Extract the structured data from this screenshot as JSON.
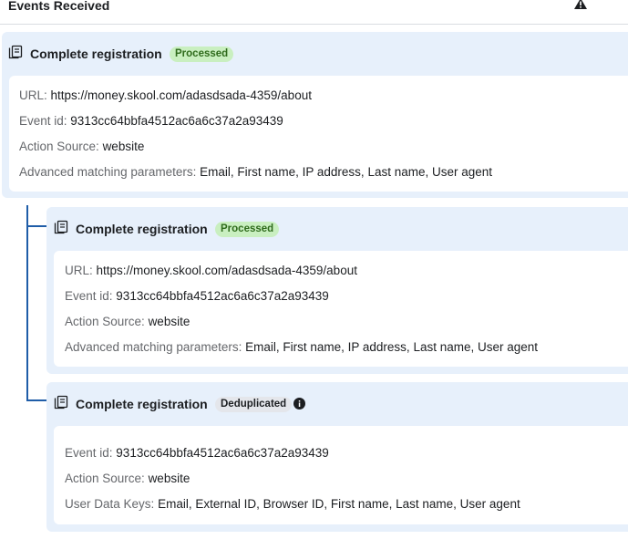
{
  "header": {
    "title": "Events Received",
    "warning_icon": "warning-triangle-icon"
  },
  "events": [
    {
      "title": "Complete registration",
      "status": "Processed",
      "rows": [
        {
          "label": "URL:",
          "value": "https://money.skool.com/adasdsada-4359/about"
        },
        {
          "label": "Event id:",
          "value": "9313cc64bbfa4512ac6a6c37a2a93439"
        },
        {
          "label": "Action Source:",
          "value": "website"
        },
        {
          "label": "Advanced matching parameters:",
          "value": "Email, First name, IP address, Last name, User agent"
        }
      ]
    },
    {
      "title": "Complete registration",
      "status": "Processed",
      "rows": [
        {
          "label": "URL:",
          "value": "https://money.skool.com/adasdsada-4359/about"
        },
        {
          "label": "Event id:",
          "value": "9313cc64bbfa4512ac6a6c37a2a93439"
        },
        {
          "label": "Action Source:",
          "value": "website"
        },
        {
          "label": "Advanced matching parameters:",
          "value": "Email, First name, IP address, Last name, User agent"
        }
      ]
    },
    {
      "title": "Complete registration",
      "status": "Deduplicated",
      "rows": [
        {
          "label": "Event id:",
          "value": "9313cc64bbfa4512ac6a6c37a2a93439"
        },
        {
          "label": "Action Source:",
          "value": "website"
        },
        {
          "label": "User Data Keys:",
          "value": "Email, External ID, Browser ID, First name, Last name, User agent"
        }
      ]
    }
  ],
  "colors": {
    "card_bg": "#e7f0fb",
    "processed_badge_bg": "#c9efc0",
    "processed_badge_text": "#2f6b1c",
    "dedup_badge_bg": "#e4e6eb",
    "tree_line": "#1f5da8"
  }
}
